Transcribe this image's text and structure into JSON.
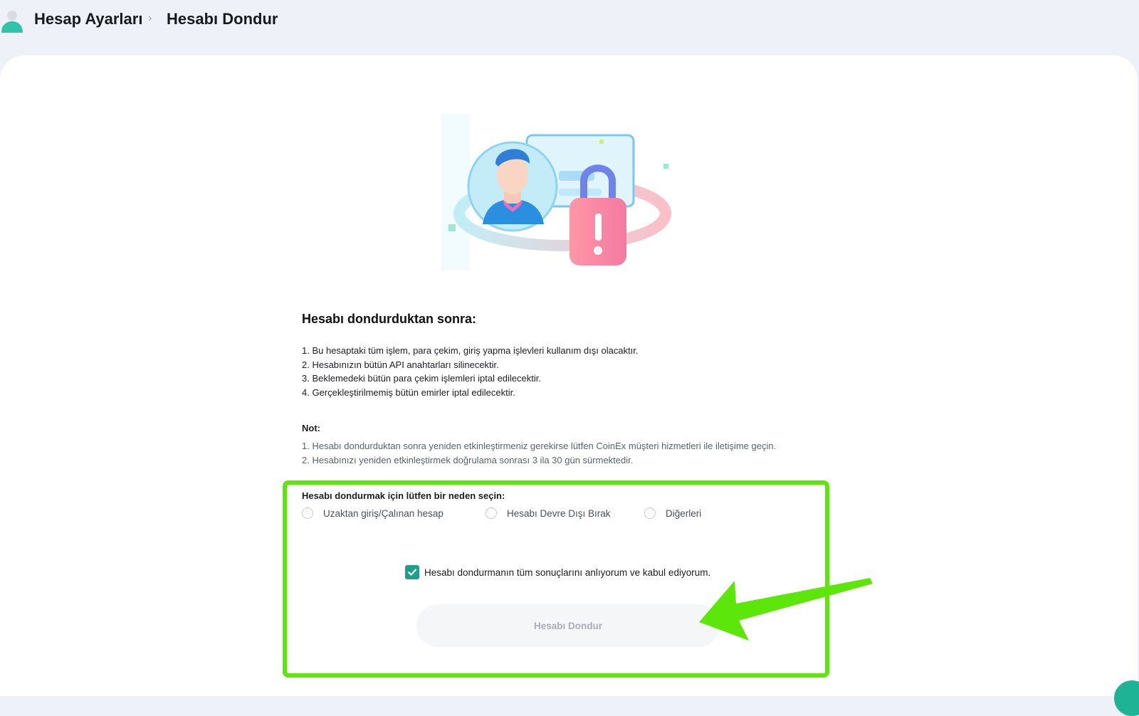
{
  "breadcrumb": {
    "parent": "Hesap Ayarları",
    "separator": "›",
    "current": "Hesabı Dondur"
  },
  "info": {
    "title": "Hesabı dondurduktan sonra:",
    "items": [
      "1. Bu hesaptaki tüm işlem, para çekim, giriş yapma işlevleri kullanım dışı olacaktır.",
      "2. Hesabınızın bütün API anahtarları silinecektir.",
      "3. Beklemedeki bütün para çekim işlemleri iptal edilecektir.",
      "4. Gerçekleştirilmemiş bütün emirler iptal edilecektir."
    ]
  },
  "notes": {
    "label": "Not:",
    "items": [
      "1. Hesabı dondurduktan sonra yeniden etkinleştirmeniz gerekirse lütfen CoinEx müşteri hizmetleri ile iletişime geçin.",
      "2. Hesabınızı yeniden etkinleştirmek doğrulama sonrası 3 ila 30 gün sürmektedir."
    ]
  },
  "reason": {
    "label": "Hesabı dondurmak için lütfen bir neden seçin:",
    "options": [
      "Uzaktan giriş/Çalınan hesap",
      "Hesabı Devre Dışı Bırak",
      "Diğerleri"
    ],
    "selected": null
  },
  "agreement": {
    "text": "Hesabı dondurmanın tüm sonuçlarını anlıyorum ve kabul ediyorum.",
    "checked": true
  },
  "submit": {
    "label": "Hesabı Dondur",
    "enabled": false
  },
  "colors": {
    "accent": "#1d9f88",
    "highlight": "#5ce60a",
    "page_bg": "#eef2f8"
  }
}
